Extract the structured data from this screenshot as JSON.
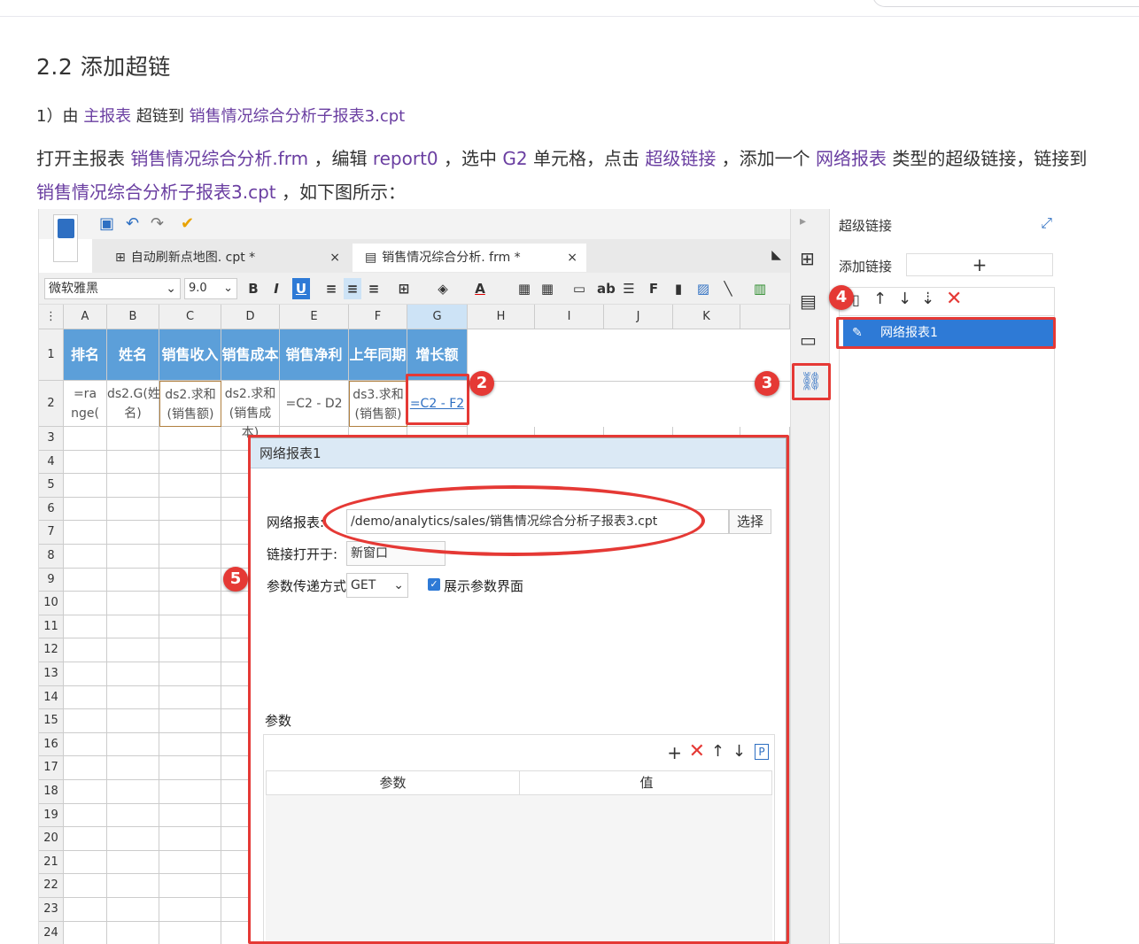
{
  "heading": "2.2 添加超链",
  "step1": {
    "prefix": "1）由 ",
    "from": "主报表",
    "mid": " 超链到 ",
    "to": "销售情况综合分析子报表3.cpt"
  },
  "desc": {
    "t1": "打开主报表 ",
    "file": "销售情况综合分析.frm",
    "t2": " ，编辑 ",
    "report": "report0",
    "t3": " ，选中 ",
    "cell": "G2",
    "t4": " 单元格，点击 ",
    "hyper": "超级链接",
    "t5": " ，添加一个 ",
    "net": "网络报表",
    "t6": " 类型的超级链接，链接到 ",
    "target": "销售情况综合分析子报表3.cpt",
    "t7": " ，如下图所示："
  },
  "designer": {
    "tabs": [
      {
        "label": "自动刷新点地图. cpt *"
      },
      {
        "label": "销售情况综合分析. frm *"
      }
    ],
    "font": "微软雅黑",
    "font_size": "9.0",
    "columns": [
      "A",
      "B",
      "C",
      "D",
      "E",
      "F",
      "G",
      "H",
      "I",
      "J",
      "K"
    ],
    "header_row": [
      "排名",
      "姓名",
      "销售收入",
      "销售成本",
      "销售净利润",
      "上年同期",
      "增长额"
    ],
    "row2": [
      "=ra\nnge(",
      "ds2.G(姓\n名)",
      "ds2.求和\n(销售额)",
      "ds2.求和\n(销售成本)",
      "=C2 - D2",
      "ds3.求和\n(销售额)",
      "=C2 - F2"
    ],
    "rows": [
      "1",
      "2",
      "3",
      "4",
      "5",
      "6",
      "7",
      "8",
      "9",
      "10",
      "11",
      "12",
      "13",
      "14",
      "15",
      "16",
      "17",
      "18",
      "19",
      "20",
      "21",
      "22",
      "23",
      "24"
    ]
  },
  "panel": {
    "title": "超级链接",
    "add_label": "添加链接",
    "item": "网络报表1"
  },
  "dialog": {
    "title": "网络报表1",
    "report_label": "网络报表:",
    "report_value": "/demo/analytics/sales/销售情况综合分析子报表3.cpt",
    "choose": "选择",
    "open_label": "链接打开于:",
    "open_value": "新窗口",
    "method_label": "参数传递方式:",
    "method_value": "GET",
    "show_params": "展示参数界面",
    "params_title": "参数",
    "col_param": "参数",
    "col_value": "值"
  },
  "badges": [
    "2",
    "3",
    "4",
    "5"
  ],
  "colors": {
    "header_blue": "#5c9fd9",
    "select_blue": "#2e7ad6",
    "annotation_red": "#e53935",
    "link_purple": "#6a3ea1"
  }
}
